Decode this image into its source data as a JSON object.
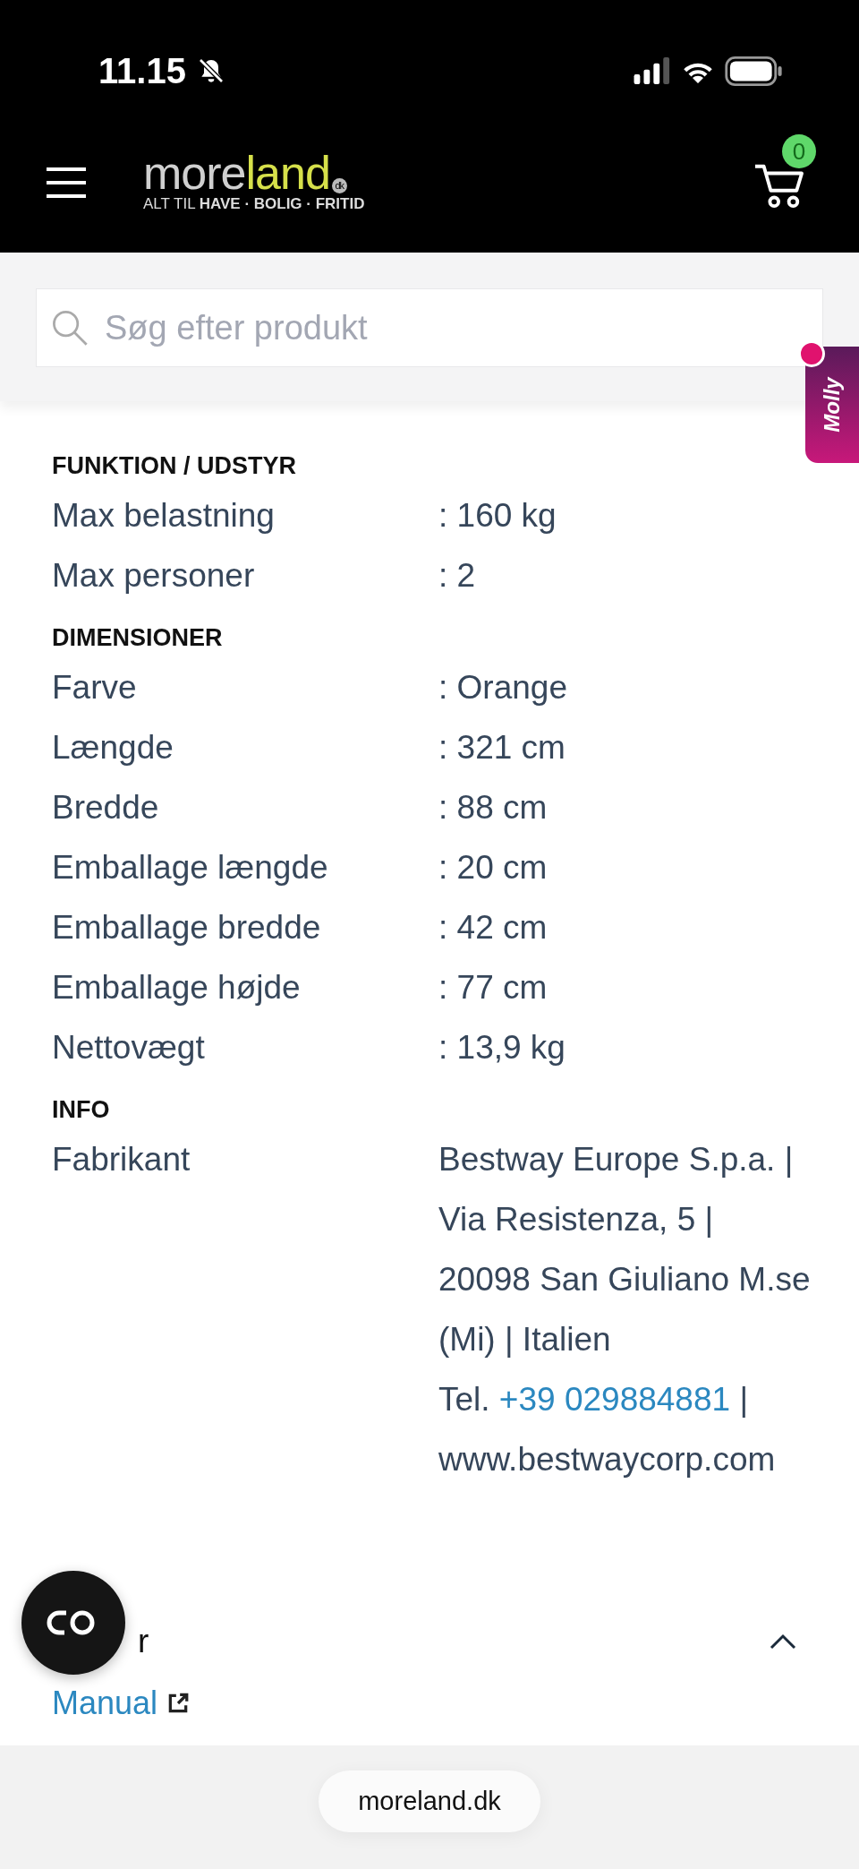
{
  "status_bar": {
    "time": "11.15"
  },
  "header": {
    "logo": {
      "first": "more",
      "second": "land",
      "badge": "dk",
      "tagline": "ALT TIL **HAVE · BOLIG · FRITID**"
    },
    "cart_count": "0"
  },
  "search": {
    "placeholder": "Søg efter produkt"
  },
  "chat_tab": {
    "label": "Molly"
  },
  "sections": [
    {
      "heading": "FUNKTION / UDSTYR",
      "rows": [
        {
          "label": "Max belastning",
          "value": ": 160 kg"
        },
        {
          "label": "Max personer",
          "value": ": 2"
        }
      ]
    },
    {
      "heading": "DIMENSIONER",
      "rows": [
        {
          "label": "Farve",
          "value": ": Orange"
        },
        {
          "label": "Længde",
          "value": ": 321 cm"
        },
        {
          "label": "Bredde",
          "value": ": 88 cm"
        },
        {
          "label": "Emballage længde",
          "value": ": 20 cm"
        },
        {
          "label": "Emballage bredde",
          "value": ": 42 cm"
        },
        {
          "label": "Emballage højde",
          "value": ": 77 cm"
        },
        {
          "label": "Nettovægt",
          "value": ": 13,9 kg"
        }
      ]
    }
  ],
  "info": {
    "heading": "INFO",
    "label": "Fabrikant",
    "address": "Bestway Europe S.p.a. | Via Resistenza, 5 | 20098 San Giuliano M.se (Mi) | Italien",
    "phone_prefix": "Tel.",
    "phone": "+39 029884881",
    "after_phone": "|",
    "website": "www.bestwaycorp.com"
  },
  "accordion": {
    "heading_fragment": "r",
    "expanded": true,
    "link": "Manual"
  },
  "browser_bar": {
    "url": "moreland.dk"
  }
}
